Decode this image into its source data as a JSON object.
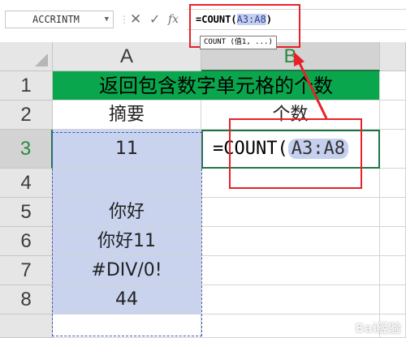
{
  "formula_bar": {
    "name_box": "ACCRINTM",
    "formula_text": "=COUNT(",
    "formula_ref": "A3:A8",
    "formula_close": ")",
    "tooltip": "COUNT (值1, ...)"
  },
  "columns": [
    "A",
    "B"
  ],
  "rows": [
    "1",
    "2",
    "3",
    "4",
    "5",
    "6",
    "7",
    "8"
  ],
  "sheet": {
    "title": "返回包含数字单元格的个数",
    "header_a": "摘要",
    "header_b": "个数",
    "a3": "11",
    "a4": "",
    "a5": "你好",
    "a6": "你好11",
    "a7": "#DIV/0!",
    "a8": "44",
    "b3_editing": "=COUNT(",
    "b3_ref": "A3:A8"
  },
  "colors": {
    "title_fill": "#0aa64d",
    "range_fill": "#c9d3ee",
    "selection_green": "#217346",
    "annotation_red": "#e8202a"
  },
  "icons": [
    "cancel-icon",
    "enter-icon",
    "fx-icon",
    "select-all-triangle-icon",
    "caret-down-icon"
  ]
}
